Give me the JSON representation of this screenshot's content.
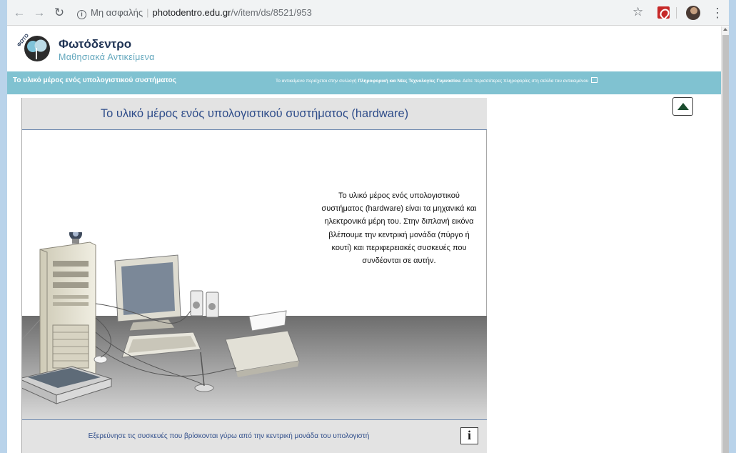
{
  "browser": {
    "security_label": "Μη ασφαλής",
    "url_host": "photodentro.edu.gr",
    "url_path": "/v/item/ds/8521/953",
    "icons": [
      "back-icon",
      "forward-icon",
      "reload-icon",
      "info-icon",
      "star-icon",
      "pdf-extension-icon",
      "profile-avatar",
      "menu-icon"
    ]
  },
  "site": {
    "brand": "Φωτόδεντρο",
    "tagline": "Μαθησιακά Αντικείμενα",
    "colors": {
      "infobar": "#80c2d1",
      "brand": "#1f3354",
      "tagline": "#63a7bd",
      "title": "#2f4d8a"
    }
  },
  "infobar": {
    "title": "Το υλικό μέρος ενός υπολογιστικού συστήματος",
    "note_prefix": "Το αντικείμενο περιέχεται στην συλλογή",
    "collection": "Πληροφορική και Νέες Τεχνολογίες Γυμνασίου",
    "note_suffix": ". Δείτε περισσότερες πληροφορίες στη σελίδα του αντικειμένου"
  },
  "stage": {
    "title": "Το υλικό μέρος ενός υπολογιστικού συστήματος (hardware)",
    "description": "Το υλικό μέρος ενός υπολογιστικού συστήματος (hardware) είναι τα μηχανικά και ηλεκτρονικά μέρη του. Στην διπλανή εικόνα βλέπουμε την κεντρική μονάδα (πύργο ή κουτί) και περιφερειακές συσκευές που συνδέονται σε αυτήν.",
    "footer_text": "Εξερεύνησε τις συσκευές που βρίσκονται γύρω από την κεντρική μονάδα του υπολογιστή",
    "info_button": "i"
  }
}
